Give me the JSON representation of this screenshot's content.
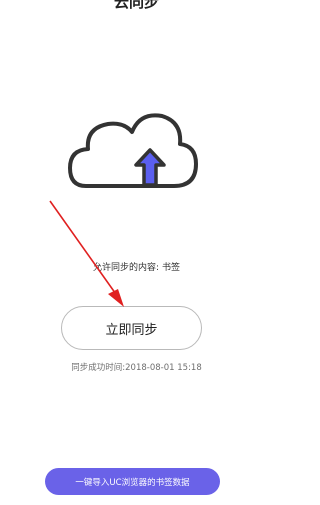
{
  "header": {
    "title": "云同步"
  },
  "icons": {
    "cloud": "cloud-upload-icon",
    "annotation": "red-arrow-annotation-icon"
  },
  "colors": {
    "cloud_stroke": "#333333",
    "upload_arrow": "#5b5ff0",
    "import_button": "#6a62e8",
    "annotation_arrow": "#e02020"
  },
  "sync": {
    "content_text": "允许同步的内容: 书签",
    "button_label": "立即同步",
    "last_sync_text": "同步成功时间:2018-08-01 15:18"
  },
  "footer": {
    "import_label": "一键导入UC浏览器的书签数据"
  }
}
